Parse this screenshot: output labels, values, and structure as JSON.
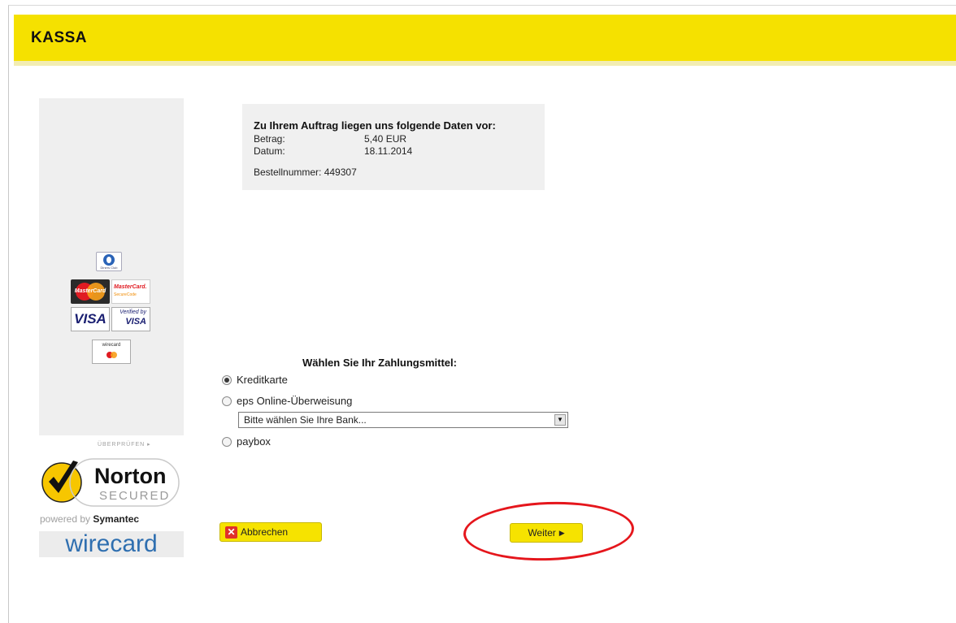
{
  "header": {
    "title": "KASSA"
  },
  "order": {
    "heading": "Zu Ihrem Auftrag liegen uns folgende Daten vor:",
    "amount_label": "Betrag:",
    "amount_value": "5,40  EUR",
    "date_label": "Datum:",
    "date_value": "18.11.2014",
    "order_number": "Bestellnummer: 449307"
  },
  "payment": {
    "heading": "Wählen Sie Ihr Zahlungsmittel:",
    "options": [
      {
        "label": "Kreditkarte",
        "checked": true
      },
      {
        "label": "eps Online-Überweisung",
        "checked": false
      },
      {
        "label": "paybox",
        "checked": false
      }
    ],
    "bank_select": {
      "selected": "Bitte wählen Sie Ihre Bank..."
    }
  },
  "buttons": {
    "cancel": "Abbrechen",
    "next": "Weiter"
  },
  "sidebar": {
    "logos": [
      "diners-club-logo",
      "mastercard-logo",
      "mastercard-securecode-logo",
      "visa-logo",
      "verified-by-visa-logo",
      "wirecard-cards-logo"
    ],
    "norton_check_label": "ÜBERPRÜFEN",
    "norton_brand": "Norton",
    "norton_secured": "SECURED",
    "powered_prefix": "powered by ",
    "powered_brand": "Symantec",
    "wirecard": "wirecard"
  },
  "colors": {
    "header_yellow": "#f5e100",
    "highlight_red": "#e5161c",
    "button_yellow": "#f6e300"
  }
}
